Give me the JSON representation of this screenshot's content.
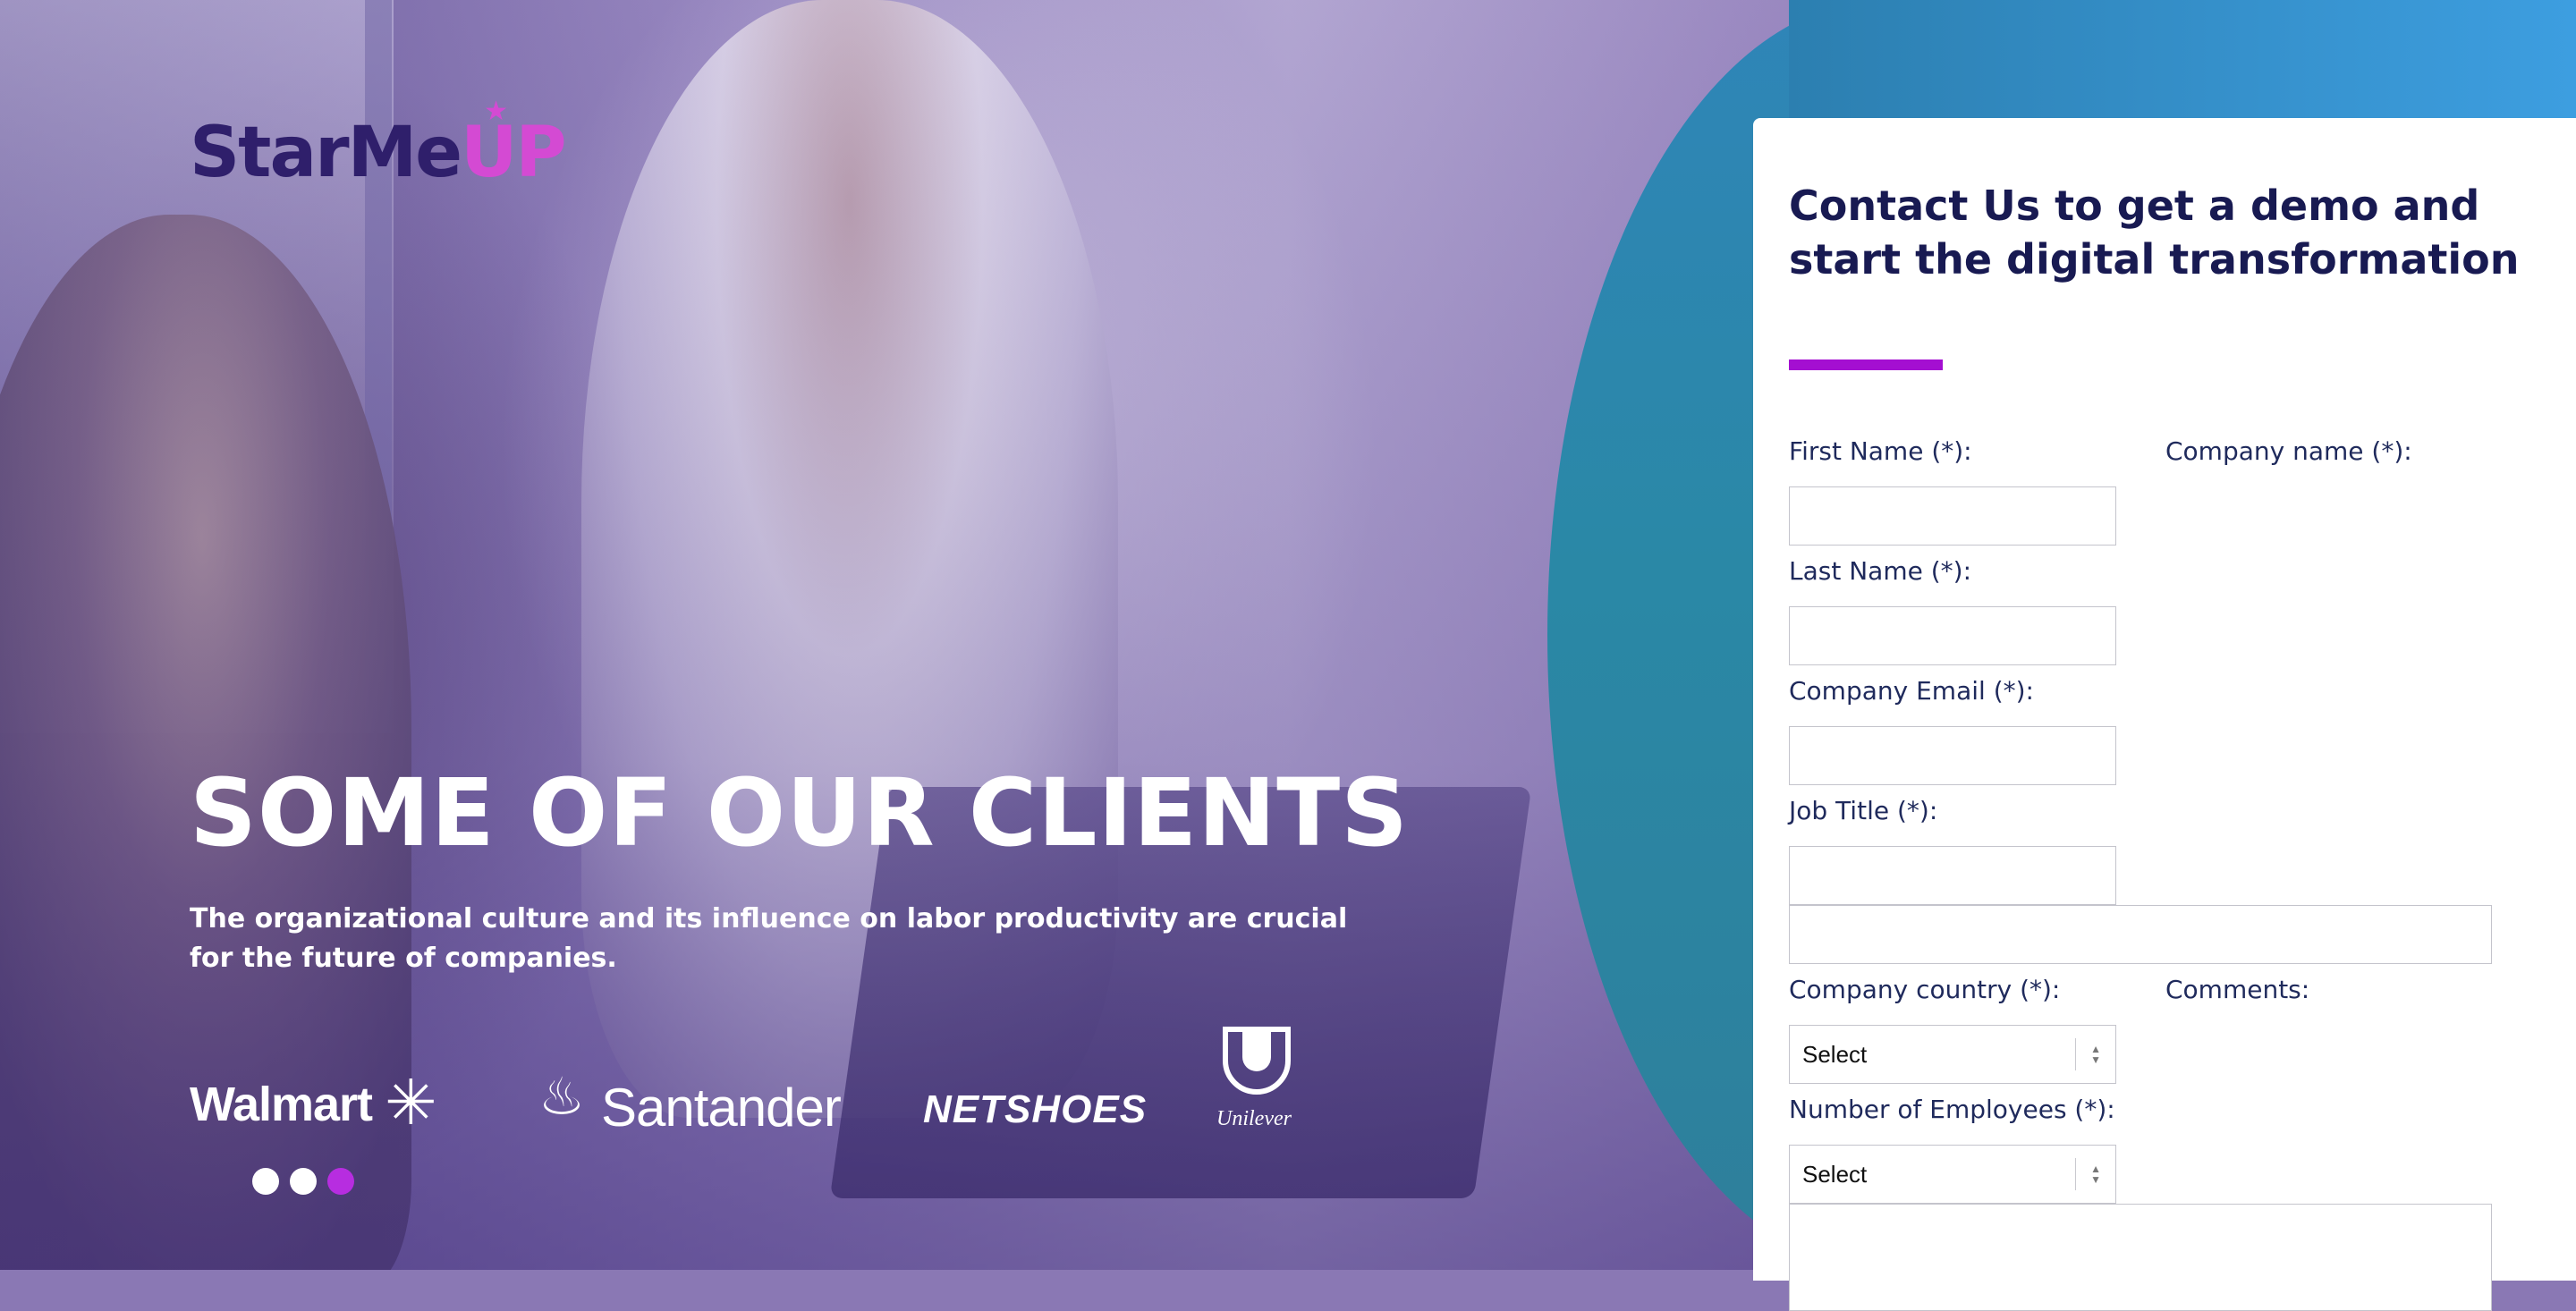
{
  "brand": {
    "logo_part1": "StarMe",
    "logo_part2": "UP",
    "logo_star": "★",
    "primary_color": "#181a52",
    "accent_color": "#a40fd1",
    "logo_pink": "#d44ad3",
    "teal_panel_color": "#2a88a6"
  },
  "hero": {
    "title": "SOME OF OUR CLIENTS",
    "subtitle": "The organizational culture and its influence on labor productivity are crucial for the future of companies.",
    "clients": {
      "walmart": "Walmart",
      "walmart_spark": "✳",
      "santander_flame": "♨",
      "santander": "Santander",
      "netshoes": "NETSHOES",
      "unilever": "Unilever"
    },
    "carousel": {
      "total": 3,
      "active_index": 2
    }
  },
  "form": {
    "heading": "Contact Us to get a demo and start the digital transformation",
    "first_name_label": "First Name (*):",
    "company_name_label": "Company name (*):",
    "last_name_label": "Last Name (*):",
    "company_email_label": "Company Email (*):",
    "job_title_label": "Job Title (*):",
    "company_country_label": "Company country (*):",
    "comments_label": "Comments:",
    "company_country_value": "Select",
    "employees_label": "Number of Employees (*):",
    "employees_value": "Select"
  }
}
